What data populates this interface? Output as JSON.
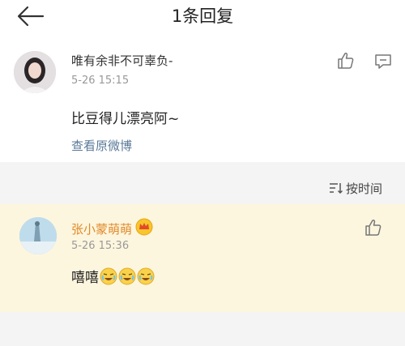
{
  "header": {
    "title": "1条回复"
  },
  "post": {
    "username": "唯有余非不可辜负-",
    "timestamp": "5-26 15:15",
    "content": "比豆得儿漂亮阿~",
    "view_original": "查看原微博"
  },
  "sort": {
    "label": "按时间"
  },
  "reply": {
    "username": "张小蒙萌萌",
    "timestamp": "5-26 15:36",
    "content": "嘻嘻",
    "emojis": [
      "laugh-cry-emoji",
      "laugh-cry-emoji",
      "laugh-cry-emoji"
    ]
  },
  "colors": {
    "reply_bg": "#fdf6de",
    "reply_username": "#e08a2a",
    "link": "#5b7a9a",
    "gray_bg": "#f4f4f4"
  },
  "icons": [
    "back-arrow-icon",
    "like-icon",
    "comment-icon",
    "sort-icon",
    "vip-crown-icon"
  ]
}
